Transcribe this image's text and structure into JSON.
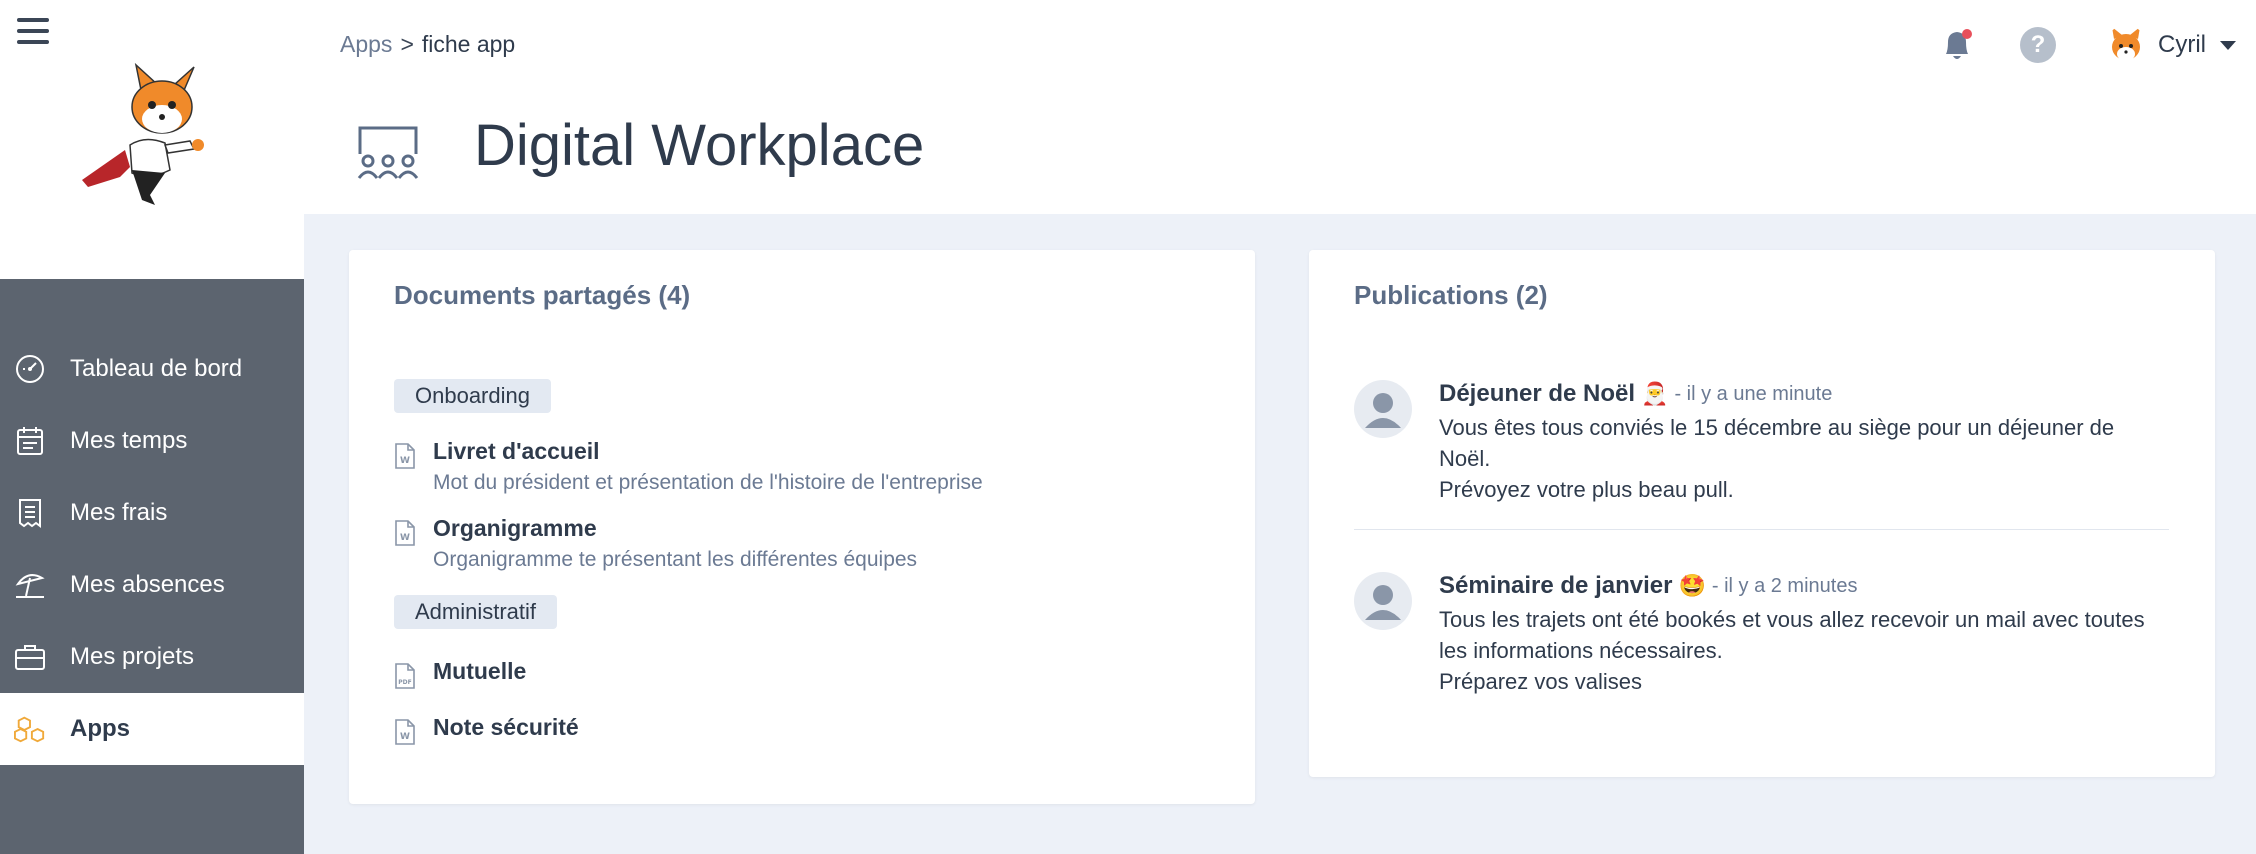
{
  "sidebar": {
    "items": [
      {
        "label": "Tableau de bord",
        "icon": "dashboard-icon"
      },
      {
        "label": "Mes temps",
        "icon": "timesheet-icon"
      },
      {
        "label": "Mes frais",
        "icon": "receipt-icon"
      },
      {
        "label": "Mes absences",
        "icon": "beach-umbrella-icon"
      },
      {
        "label": "Mes projets",
        "icon": "briefcase-icon"
      },
      {
        "label": "Apps",
        "icon": "cubes-icon",
        "active": true
      }
    ]
  },
  "header": {
    "breadcrumb": {
      "root": "Apps",
      "separator": ">",
      "current": "fiche app"
    },
    "title": "Digital Workplace",
    "help_label": "?",
    "user": {
      "name": "Cyril"
    }
  },
  "documents": {
    "title": "Documents partagés (4)",
    "groups": [
      {
        "label": "Onboarding",
        "items": [
          {
            "name": "Livret d'accueil",
            "description": "Mot du président et présentation de l'histoire de l'entreprise",
            "type": "word"
          },
          {
            "name": "Organigramme",
            "description": "Organigramme te présentant les différentes équipes",
            "type": "word"
          }
        ]
      },
      {
        "label": "Administratif",
        "items": [
          {
            "name": "Mutuelle",
            "description": "",
            "type": "pdf"
          },
          {
            "name": "Note sécurité",
            "description": "",
            "type": "word"
          }
        ]
      }
    ]
  },
  "publications": {
    "title": "Publications (2)",
    "items": [
      {
        "title": "Déjeuner de Noël",
        "emoji": "🎅",
        "time": "- il y a une minute",
        "body": "Vous êtes tous conviés le 15 décembre au siège pour un déjeuner de Noël.",
        "body2": "Prévoyez votre plus beau pull."
      },
      {
        "title": "Séminaire de janvier",
        "emoji": "🤩",
        "time": "- il y a 2 minutes",
        "body": "Tous les trajets ont été bookés et vous allez recevoir un mail avec toutes les informations nécessaires.",
        "body2": "Préparez vos valises"
      }
    ]
  },
  "colors": {
    "sidebar_bg": "#5c646f",
    "page_bg": "#edf1f8",
    "text_dark": "#2f3b4c",
    "text_muted": "#6b7a93",
    "notification_dot": "#e8505b",
    "apps_icon_accent": "#f0a93a"
  }
}
